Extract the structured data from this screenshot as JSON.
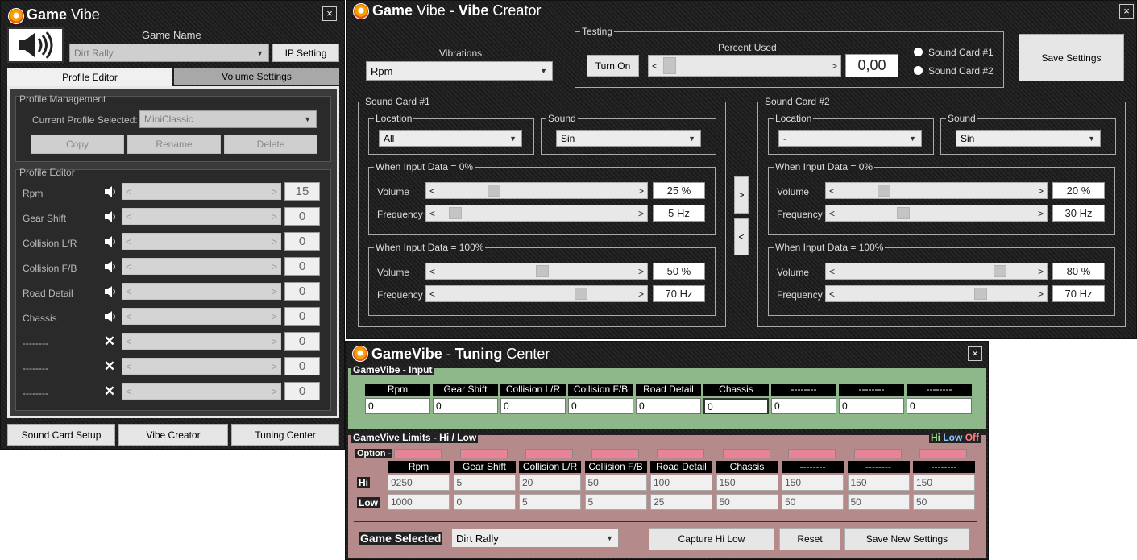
{
  "main": {
    "title_a": "Game",
    "title_b": " Vibe",
    "game_name_label": "Game Name",
    "game_select": "Dirt Rally",
    "ip_button": "IP Setting",
    "tabs": [
      "Profile Editor",
      "Volume Settings"
    ],
    "pm_title": "Profile Management",
    "current_label": "Current Profile Selected:",
    "current_value": "MiniClassic",
    "pm_buttons": [
      "Copy",
      "Rename",
      "Delete"
    ],
    "pe_title": "Profile Editor",
    "rows": [
      {
        "label": "Rpm",
        "value": "15",
        "icon": "speaker-icon"
      },
      {
        "label": "Gear Shift",
        "value": "0",
        "icon": "speaker-icon"
      },
      {
        "label": "Collision L/R",
        "value": "0",
        "icon": "speaker-icon"
      },
      {
        "label": "Collision F/B",
        "value": "0",
        "icon": "speaker-icon"
      },
      {
        "label": "Road Detail",
        "value": "0",
        "icon": "speaker-icon"
      },
      {
        "label": "Chassis",
        "value": "0",
        "icon": "speaker-icon"
      },
      {
        "label": "--------",
        "value": "0",
        "icon": "x-icon"
      },
      {
        "label": "--------",
        "value": "0",
        "icon": "x-icon"
      },
      {
        "label": "--------",
        "value": "0",
        "icon": "x-icon"
      }
    ],
    "bottom_buttons": [
      "Sound Card Setup",
      "Vibe Creator",
      "Tuning Center"
    ],
    "close": "×"
  },
  "vibe": {
    "title_a": "Game",
    "title_b": " Vibe - ",
    "title_c": "Vibe",
    "title_d": " Creator",
    "vibrations_label": "Vibrations",
    "vibrations_value": "Rpm",
    "testing_label": "Testing",
    "turn_on": "Turn On",
    "percent_label": "Percent Used",
    "percent_value": "0,00",
    "radio1": "Sound Card #1",
    "radio2": "Sound Card #2",
    "save": "Save Settings",
    "close": "×",
    "copy_right": ">",
    "copy_left": "<",
    "cards": [
      {
        "title": "Sound Card #1",
        "location_label": "Location",
        "location": "All",
        "sound_label": "Sound",
        "sound": "Sin",
        "g0": "When Input Data = 0%",
        "g100": "When Input Data = 100%",
        "vol_label": "Volume",
        "freq_label": "Frequency",
        "vol0": "25 %",
        "freq0": "5 Hz",
        "vol100": "50 %",
        "freq100": "70 Hz",
        "vol0_pos": 0.25,
        "freq0_pos": 0.05,
        "vol100_pos": 0.5,
        "freq100_pos": 0.7
      },
      {
        "title": "Sound Card #2",
        "location_label": "Location",
        "location": "-",
        "sound_label": "Sound",
        "sound": "Sin",
        "g0": "When Input Data = 0%",
        "g100": "When Input Data = 100%",
        "vol_label": "Volume",
        "freq_label": "Frequency",
        "vol0": "20 %",
        "freq0": "30 Hz",
        "vol100": "80 %",
        "freq100": "70 Hz",
        "vol0_pos": 0.2,
        "freq0_pos": 0.3,
        "vol100_pos": 0.8,
        "freq100_pos": 0.7
      }
    ]
  },
  "tuning": {
    "title_a": "GameVibe",
    "title_b": " - ",
    "title_c": "Tuning",
    "title_d": " Center",
    "close": "×",
    "input_title": "GameVibe - Input",
    "headers": [
      "Rpm",
      "Gear Shift",
      "Collision L/R",
      "Collision F/B",
      "Road Detail",
      "Chassis",
      "--------",
      "--------",
      "--------"
    ],
    "inputs": [
      "0",
      "0",
      "0",
      "0",
      "0",
      "0",
      "0",
      "0",
      "0"
    ],
    "limits_title": "GameVive Limits - Hi / Low",
    "legend_hi": "Hi",
    "legend_low": "Low",
    "legend_off": "Off",
    "option_label": "Option -",
    "hi_label": "Hi",
    "low_label": "Low",
    "hi": [
      "9250",
      "5",
      "20",
      "50",
      "100",
      "150",
      "150",
      "150",
      "150"
    ],
    "low": [
      "1000",
      "0",
      "5",
      "5",
      "25",
      "50",
      "50",
      "50",
      "50"
    ],
    "game_selected_label": "Game Selected",
    "game_selected": "Dirt Rally",
    "capture": "Capture Hi Low",
    "reset": "Reset",
    "save_new": "Save New Settings"
  }
}
